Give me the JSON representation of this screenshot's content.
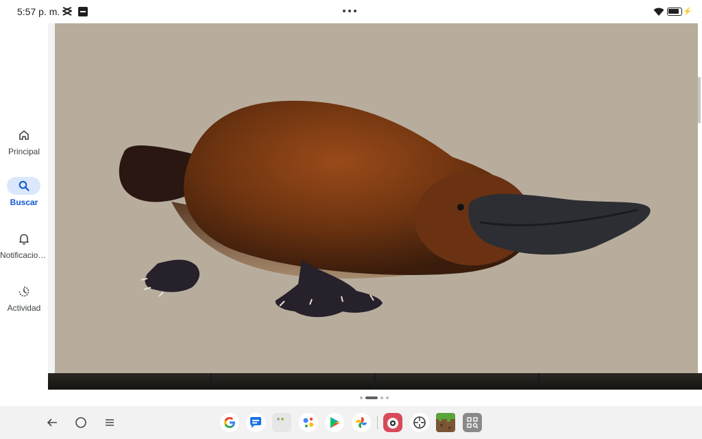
{
  "status_bar": {
    "time": "5:57 p. m.",
    "icons": [
      "capcut-icon",
      "app-notification-icon",
      "more-dots-icon",
      "wifi-icon",
      "battery-icon",
      "charging-icon"
    ]
  },
  "nav_rail": {
    "items": [
      {
        "label": "Principal",
        "icon": "home-icon",
        "active": false
      },
      {
        "label": "Buscar",
        "icon": "search-icon",
        "active": true
      },
      {
        "label": "Notificaciones",
        "icon": "bell-icon",
        "active": false
      },
      {
        "label": "Actividad",
        "icon": "activity-icon",
        "active": false
      }
    ]
  },
  "main": {
    "image_subject": "platypus",
    "thumbnail_count": 4,
    "page_indicator": {
      "count": 4,
      "active_index": 1
    }
  },
  "taskbar": {
    "system_buttons": [
      "back-icon",
      "home-circle-icon",
      "recents-menu-icon"
    ],
    "dock_apps": [
      "google-app-icon",
      "messages-app-icon",
      "app-folder-icon",
      "assistant-app-icon",
      "play-store-app-icon",
      "photos-app-icon",
      "mobile-game-app-icon",
      "tracking-app-icon",
      "minecraft-app-icon",
      "qr-scanner-app-icon"
    ]
  },
  "colors": {
    "accent": "#0b57d0",
    "accent_pill": "#dbe7fb",
    "image_background": "#b8ad9d"
  }
}
